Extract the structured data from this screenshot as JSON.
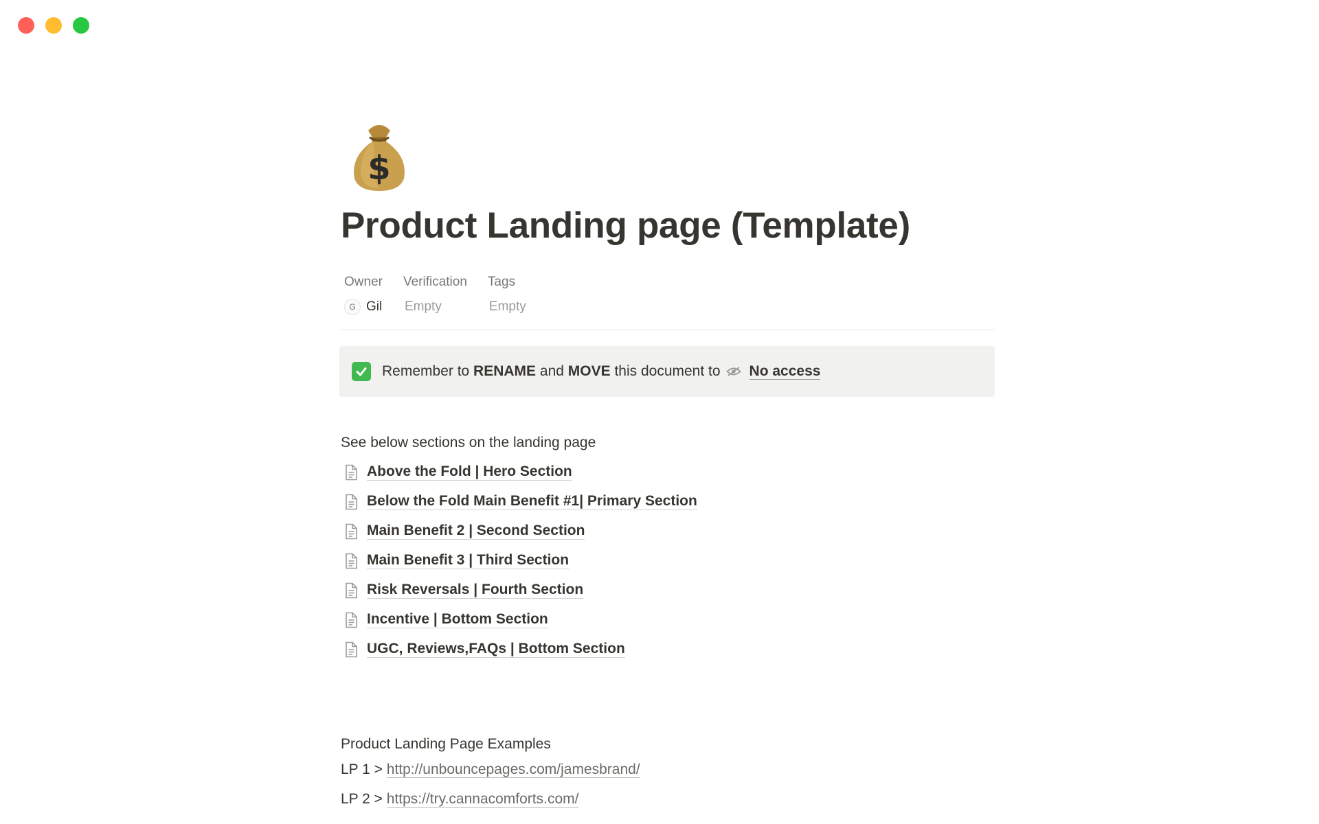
{
  "window": {
    "controls": [
      {
        "name": "close",
        "color": "#ff5f57"
      },
      {
        "name": "minimize",
        "color": "#febc2e"
      },
      {
        "name": "zoom",
        "color": "#28c840"
      }
    ]
  },
  "page": {
    "icon": "money-bag-emoji",
    "title": "Product Landing page (Template)",
    "properties": [
      {
        "name": "Owner",
        "avatar_initial": "G",
        "value": "Gil"
      },
      {
        "name": "Verification",
        "value": "Empty"
      },
      {
        "name": "Tags",
        "value": "Empty"
      }
    ]
  },
  "callout": {
    "icon": "check-mark-icon",
    "text_before": "Remember to ",
    "bold_rename": "RENAME",
    "text_and": " and ",
    "bold_move": "MOVE",
    "text_after": " this document to",
    "link_icon": "eye-slash-icon",
    "link_text": "No access"
  },
  "sections": {
    "heading": "See below sections on the landing page",
    "links": [
      "Above the Fold | Hero Section",
      "Below the Fold Main Benefit #1| Primary Section",
      "Main Benefit 2 | Second Section",
      "Main Benefit 3 | Third Section",
      "Risk Reversals | Fourth Section",
      "Incentive | Bottom Section",
      "UGC, Reviews,FAQs | Bottom Section"
    ]
  },
  "examples": {
    "heading": "Product Landing Page Examples",
    "items": [
      {
        "label": "LP 1 > ",
        "url": "http://unbouncepages.com/jamesbrand/"
      },
      {
        "label": "LP 2 > ",
        "url": "https://try.cannacomforts.com/"
      }
    ]
  }
}
